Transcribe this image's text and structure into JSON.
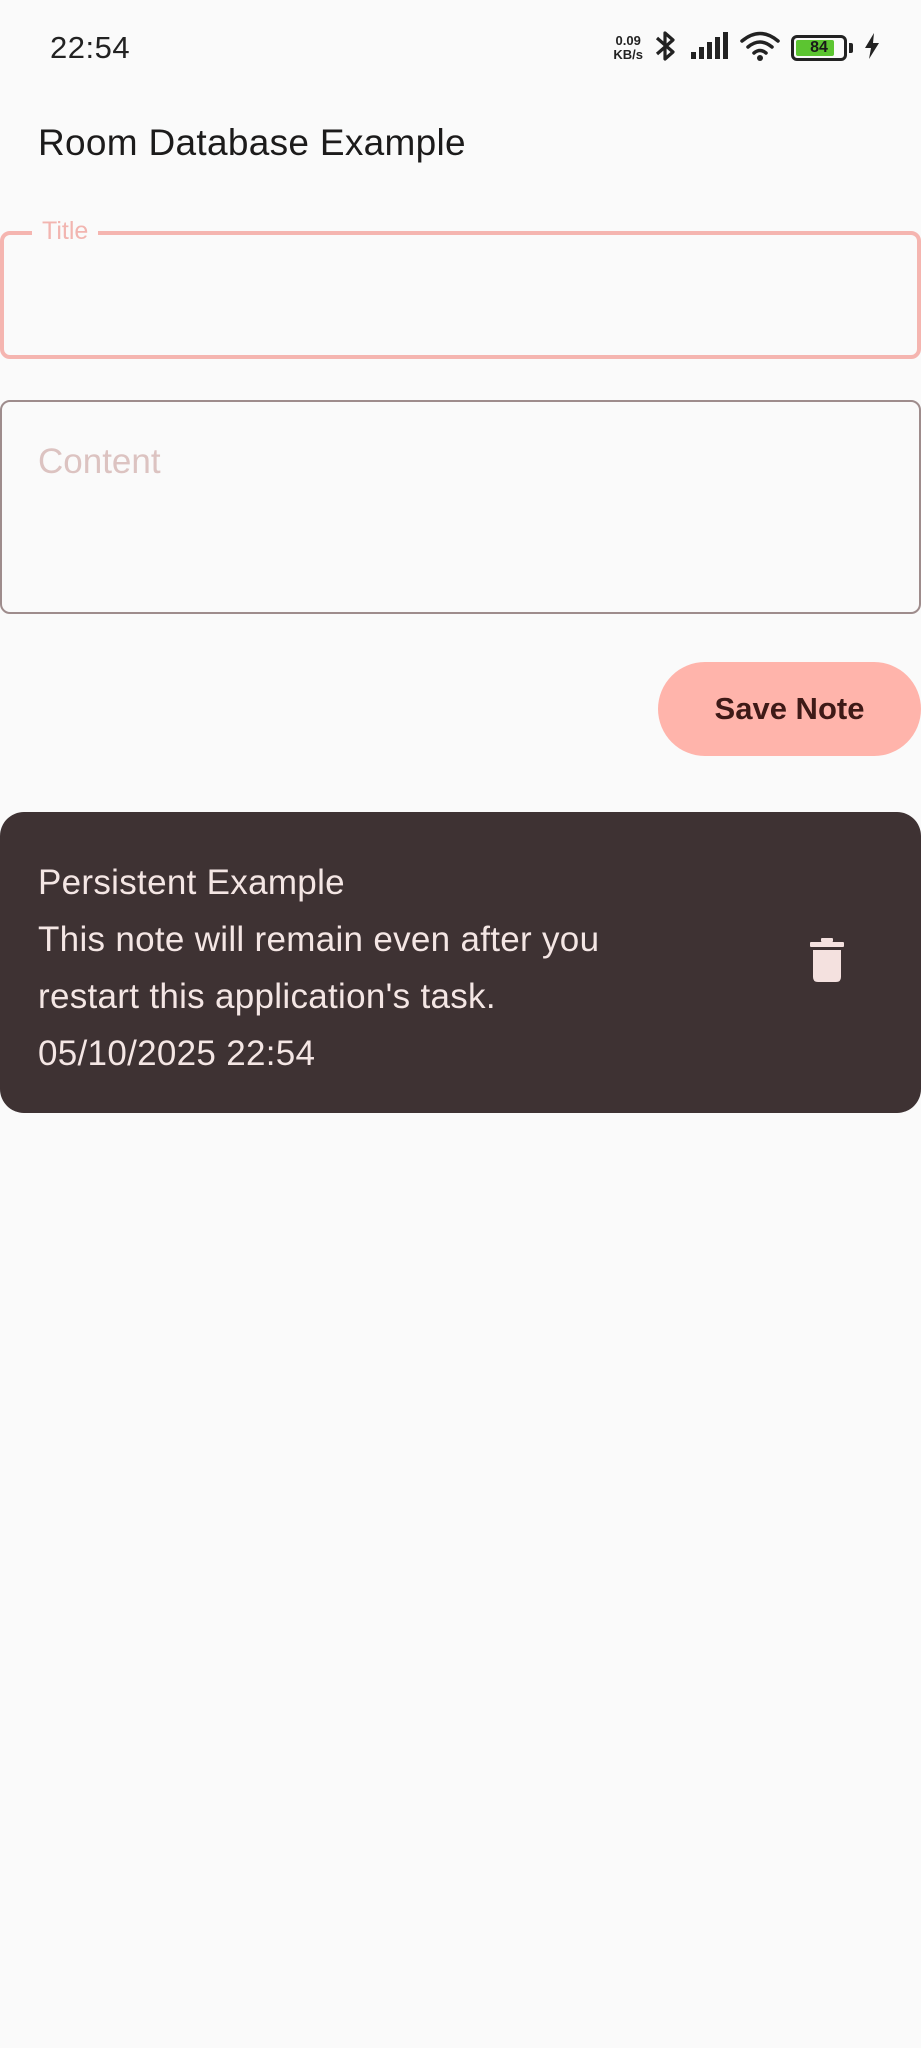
{
  "status_bar": {
    "time": "22:54",
    "net_speed_value": "0.09",
    "net_speed_unit": "KB/s",
    "battery_level": "84",
    "battery_fraction": 0.84,
    "battery_color": "#5cc531",
    "icons": [
      "bluetooth-icon",
      "signal-icon",
      "wifi-icon",
      "battery-icon",
      "charging-icon"
    ]
  },
  "app_bar": {
    "title": "Room Database Example"
  },
  "form": {
    "title_label": "Title",
    "title_value": "",
    "content_placeholder": "Content",
    "content_value": "",
    "save_label": "Save Note"
  },
  "notes": [
    {
      "title": "Persistent Example",
      "content_line1": "This note will remain even after you",
      "content_line2": "restart this application's task.",
      "timestamp": "05/10/2025 22:54",
      "action_icon": "trash-icon"
    }
  ],
  "colors": {
    "accent": "#ffb4ab",
    "focused_outline": "#f5b5b0",
    "card_background": "#3e3233",
    "card_text": "#f4e6e4"
  }
}
